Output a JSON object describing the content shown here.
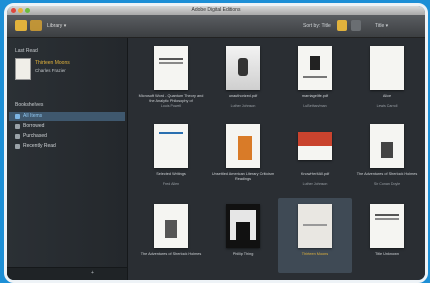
{
  "window": {
    "title": "Adobe Digital Editions"
  },
  "toolbar": {
    "library_label": "Library",
    "library_chevron": "▾",
    "sort_label": "Sort by: Title",
    "view_label": "Title",
    "view_chevron": "▾"
  },
  "sidebar": {
    "last_read_label": "Last Read",
    "last_read": {
      "title": "Thirteen Moons",
      "author": "Charles Frazier"
    },
    "bookshelves_label": "Bookshelves",
    "items": [
      {
        "label": "All Items",
        "selected": true
      },
      {
        "label": "Borrowed",
        "selected": false
      },
      {
        "label": "Purchased",
        "selected": false
      },
      {
        "label": "Recently Read",
        "selected": false
      }
    ],
    "add_label": "+"
  },
  "books": [
    {
      "title": "Microsoft Word - Quantum Theory and the Analytic Philosophy of",
      "author": "Louis Powell"
    },
    {
      "title": "unauthorized.pdf",
      "author": "Luther Johnson"
    },
    {
      "title": "marriagelife.pdf",
      "author": "LuBethan/man"
    },
    {
      "title": "Alice",
      "author": "Lewis Carroll"
    },
    {
      "title": "Selected Writings",
      "author": "Fred Allen"
    },
    {
      "title": "Unsettled American Literary Criticism Readings",
      "author": ""
    },
    {
      "title": "KnowHerItAll.pdf",
      "author": "Luther Johnson"
    },
    {
      "title": "The Adventures of Sherlock Holmes",
      "author": "Sir Conan Doyle"
    },
    {
      "title": "The Adventures of Sherlock Holmes",
      "author": ""
    },
    {
      "title": "Phillip Thing",
      "author": ""
    },
    {
      "title": "Thirteen Moons",
      "author": ""
    },
    {
      "title": "Title Unknown",
      "author": ""
    }
  ]
}
